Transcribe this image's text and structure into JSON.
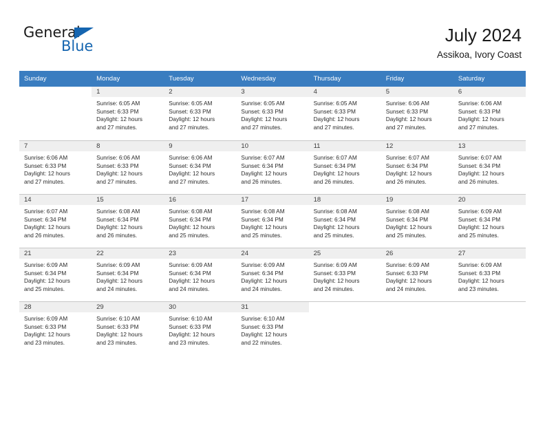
{
  "brand": {
    "name_part1": "General",
    "name_part2": "Blue",
    "accent_color": "#1565b0",
    "triangle_icon": "triangle-icon"
  },
  "header": {
    "title": "July 2024",
    "location": "Assikoa, Ivory Coast"
  },
  "calendar": {
    "header_bg": "#3a7dc0",
    "daynum_bg": "#efefef",
    "weekday_headers": [
      "Sunday",
      "Monday",
      "Tuesday",
      "Wednesday",
      "Thursday",
      "Friday",
      "Saturday"
    ],
    "weeks": [
      [
        {
          "day": "",
          "lines": []
        },
        {
          "day": "1",
          "lines": [
            "Sunrise: 6:05 AM",
            "Sunset: 6:33 PM",
            "Daylight: 12 hours",
            "and 27 minutes."
          ]
        },
        {
          "day": "2",
          "lines": [
            "Sunrise: 6:05 AM",
            "Sunset: 6:33 PM",
            "Daylight: 12 hours",
            "and 27 minutes."
          ]
        },
        {
          "day": "3",
          "lines": [
            "Sunrise: 6:05 AM",
            "Sunset: 6:33 PM",
            "Daylight: 12 hours",
            "and 27 minutes."
          ]
        },
        {
          "day": "4",
          "lines": [
            "Sunrise: 6:05 AM",
            "Sunset: 6:33 PM",
            "Daylight: 12 hours",
            "and 27 minutes."
          ]
        },
        {
          "day": "5",
          "lines": [
            "Sunrise: 6:06 AM",
            "Sunset: 6:33 PM",
            "Daylight: 12 hours",
            "and 27 minutes."
          ]
        },
        {
          "day": "6",
          "lines": [
            "Sunrise: 6:06 AM",
            "Sunset: 6:33 PM",
            "Daylight: 12 hours",
            "and 27 minutes."
          ]
        }
      ],
      [
        {
          "day": "7",
          "lines": [
            "Sunrise: 6:06 AM",
            "Sunset: 6:33 PM",
            "Daylight: 12 hours",
            "and 27 minutes."
          ]
        },
        {
          "day": "8",
          "lines": [
            "Sunrise: 6:06 AM",
            "Sunset: 6:33 PM",
            "Daylight: 12 hours",
            "and 27 minutes."
          ]
        },
        {
          "day": "9",
          "lines": [
            "Sunrise: 6:06 AM",
            "Sunset: 6:34 PM",
            "Daylight: 12 hours",
            "and 27 minutes."
          ]
        },
        {
          "day": "10",
          "lines": [
            "Sunrise: 6:07 AM",
            "Sunset: 6:34 PM",
            "Daylight: 12 hours",
            "and 26 minutes."
          ]
        },
        {
          "day": "11",
          "lines": [
            "Sunrise: 6:07 AM",
            "Sunset: 6:34 PM",
            "Daylight: 12 hours",
            "and 26 minutes."
          ]
        },
        {
          "day": "12",
          "lines": [
            "Sunrise: 6:07 AM",
            "Sunset: 6:34 PM",
            "Daylight: 12 hours",
            "and 26 minutes."
          ]
        },
        {
          "day": "13",
          "lines": [
            "Sunrise: 6:07 AM",
            "Sunset: 6:34 PM",
            "Daylight: 12 hours",
            "and 26 minutes."
          ]
        }
      ],
      [
        {
          "day": "14",
          "lines": [
            "Sunrise: 6:07 AM",
            "Sunset: 6:34 PM",
            "Daylight: 12 hours",
            "and 26 minutes."
          ]
        },
        {
          "day": "15",
          "lines": [
            "Sunrise: 6:08 AM",
            "Sunset: 6:34 PM",
            "Daylight: 12 hours",
            "and 26 minutes."
          ]
        },
        {
          "day": "16",
          "lines": [
            "Sunrise: 6:08 AM",
            "Sunset: 6:34 PM",
            "Daylight: 12 hours",
            "and 25 minutes."
          ]
        },
        {
          "day": "17",
          "lines": [
            "Sunrise: 6:08 AM",
            "Sunset: 6:34 PM",
            "Daylight: 12 hours",
            "and 25 minutes."
          ]
        },
        {
          "day": "18",
          "lines": [
            "Sunrise: 6:08 AM",
            "Sunset: 6:34 PM",
            "Daylight: 12 hours",
            "and 25 minutes."
          ]
        },
        {
          "day": "19",
          "lines": [
            "Sunrise: 6:08 AM",
            "Sunset: 6:34 PM",
            "Daylight: 12 hours",
            "and 25 minutes."
          ]
        },
        {
          "day": "20",
          "lines": [
            "Sunrise: 6:09 AM",
            "Sunset: 6:34 PM",
            "Daylight: 12 hours",
            "and 25 minutes."
          ]
        }
      ],
      [
        {
          "day": "21",
          "lines": [
            "Sunrise: 6:09 AM",
            "Sunset: 6:34 PM",
            "Daylight: 12 hours",
            "and 25 minutes."
          ]
        },
        {
          "day": "22",
          "lines": [
            "Sunrise: 6:09 AM",
            "Sunset: 6:34 PM",
            "Daylight: 12 hours",
            "and 24 minutes."
          ]
        },
        {
          "day": "23",
          "lines": [
            "Sunrise: 6:09 AM",
            "Sunset: 6:34 PM",
            "Daylight: 12 hours",
            "and 24 minutes."
          ]
        },
        {
          "day": "24",
          "lines": [
            "Sunrise: 6:09 AM",
            "Sunset: 6:34 PM",
            "Daylight: 12 hours",
            "and 24 minutes."
          ]
        },
        {
          "day": "25",
          "lines": [
            "Sunrise: 6:09 AM",
            "Sunset: 6:33 PM",
            "Daylight: 12 hours",
            "and 24 minutes."
          ]
        },
        {
          "day": "26",
          "lines": [
            "Sunrise: 6:09 AM",
            "Sunset: 6:33 PM",
            "Daylight: 12 hours",
            "and 24 minutes."
          ]
        },
        {
          "day": "27",
          "lines": [
            "Sunrise: 6:09 AM",
            "Sunset: 6:33 PM",
            "Daylight: 12 hours",
            "and 23 minutes."
          ]
        }
      ],
      [
        {
          "day": "28",
          "lines": [
            "Sunrise: 6:09 AM",
            "Sunset: 6:33 PM",
            "Daylight: 12 hours",
            "and 23 minutes."
          ]
        },
        {
          "day": "29",
          "lines": [
            "Sunrise: 6:10 AM",
            "Sunset: 6:33 PM",
            "Daylight: 12 hours",
            "and 23 minutes."
          ]
        },
        {
          "day": "30",
          "lines": [
            "Sunrise: 6:10 AM",
            "Sunset: 6:33 PM",
            "Daylight: 12 hours",
            "and 23 minutes."
          ]
        },
        {
          "day": "31",
          "lines": [
            "Sunrise: 6:10 AM",
            "Sunset: 6:33 PM",
            "Daylight: 12 hours",
            "and 22 minutes."
          ]
        },
        {
          "day": "",
          "lines": []
        },
        {
          "day": "",
          "lines": []
        },
        {
          "day": "",
          "lines": []
        }
      ]
    ]
  }
}
